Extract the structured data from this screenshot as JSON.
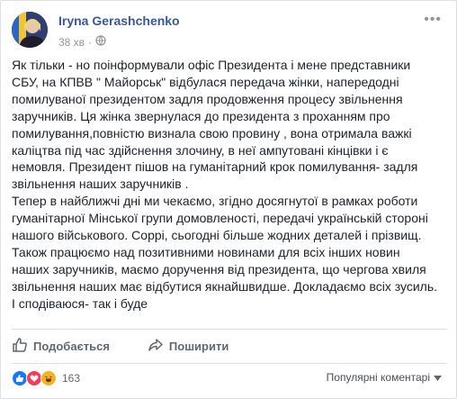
{
  "post": {
    "author": "Iryna Gerashchenko",
    "time": "38 хв",
    "body": "Як тільки - но поінформували офіс Президента і мене представники\nСБУ, на КПВВ \" Майорськ\" відбулася передача жінки, напередодні\nпомилуваної президентом задля продовження процесу звільнення\nзаручників. Ця жінка звернулася до президента з проханням про\nпомилування,повністю визнала свою провину , вона отримала важкі\nкаліцтва під час здійснення злочину, в неї ампутовані кінцівки і є\nнемовля. Президент пішов на гуманітарний крок помилування- задля\nзвільнення наших заручників .\nТепер в найближчі дні ми чекаємо, згідно досягнутої в рамках роботи\nгуманітарної Мінської групи домовленості, передачі українській стороні\nнашого військового. Соррі, сьогодні більше жодних деталей і прізвищ.\nТакож працюємо над позитивними новинами для всіх інших новин\nнаших заручників, маємо доручення від президента, що чергова хвиля\nзвільнення наших має відбутися якнайшвидше. Докладаємо всіх зусиль.\nІ сподіваюся- так і буде"
  },
  "actions": {
    "like_label": "Подобається",
    "share_label": "Поширити"
  },
  "reactions": {
    "count": "163",
    "sort_label": "Популярні коментарі"
  },
  "colors": {
    "link_blue": "#385898",
    "like_blue": "#1877f2",
    "love_red": "#f33e58",
    "haha_yellow": "#f7b125"
  }
}
